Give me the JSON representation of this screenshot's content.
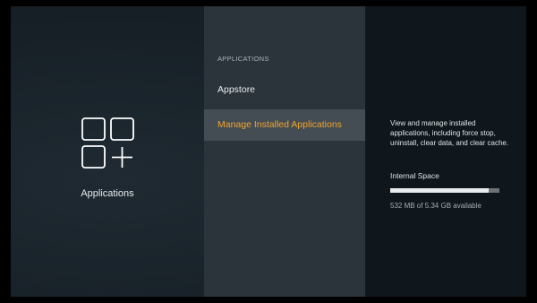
{
  "left_pane": {
    "category_label": "Applications",
    "icon": "applications-grid-icon"
  },
  "middle_pane": {
    "section_header": "APPLICATIONS",
    "items": [
      {
        "label": "Appstore",
        "selected": false
      },
      {
        "label": "Manage Installed Applications",
        "selected": true
      }
    ]
  },
  "right_pane": {
    "description": "View and manage installed applications, including force stop, uninstall, clear data, and clear cache.",
    "storage": {
      "title": "Internal Space",
      "used_fraction": 0.9,
      "caption": "532 MB of 5.34 GB available"
    }
  },
  "colors": {
    "background": "#172027",
    "middle_pane": "#2b343b",
    "right_pane": "#10171c",
    "selection": "#444d53",
    "accent": "#f0a42c"
  }
}
